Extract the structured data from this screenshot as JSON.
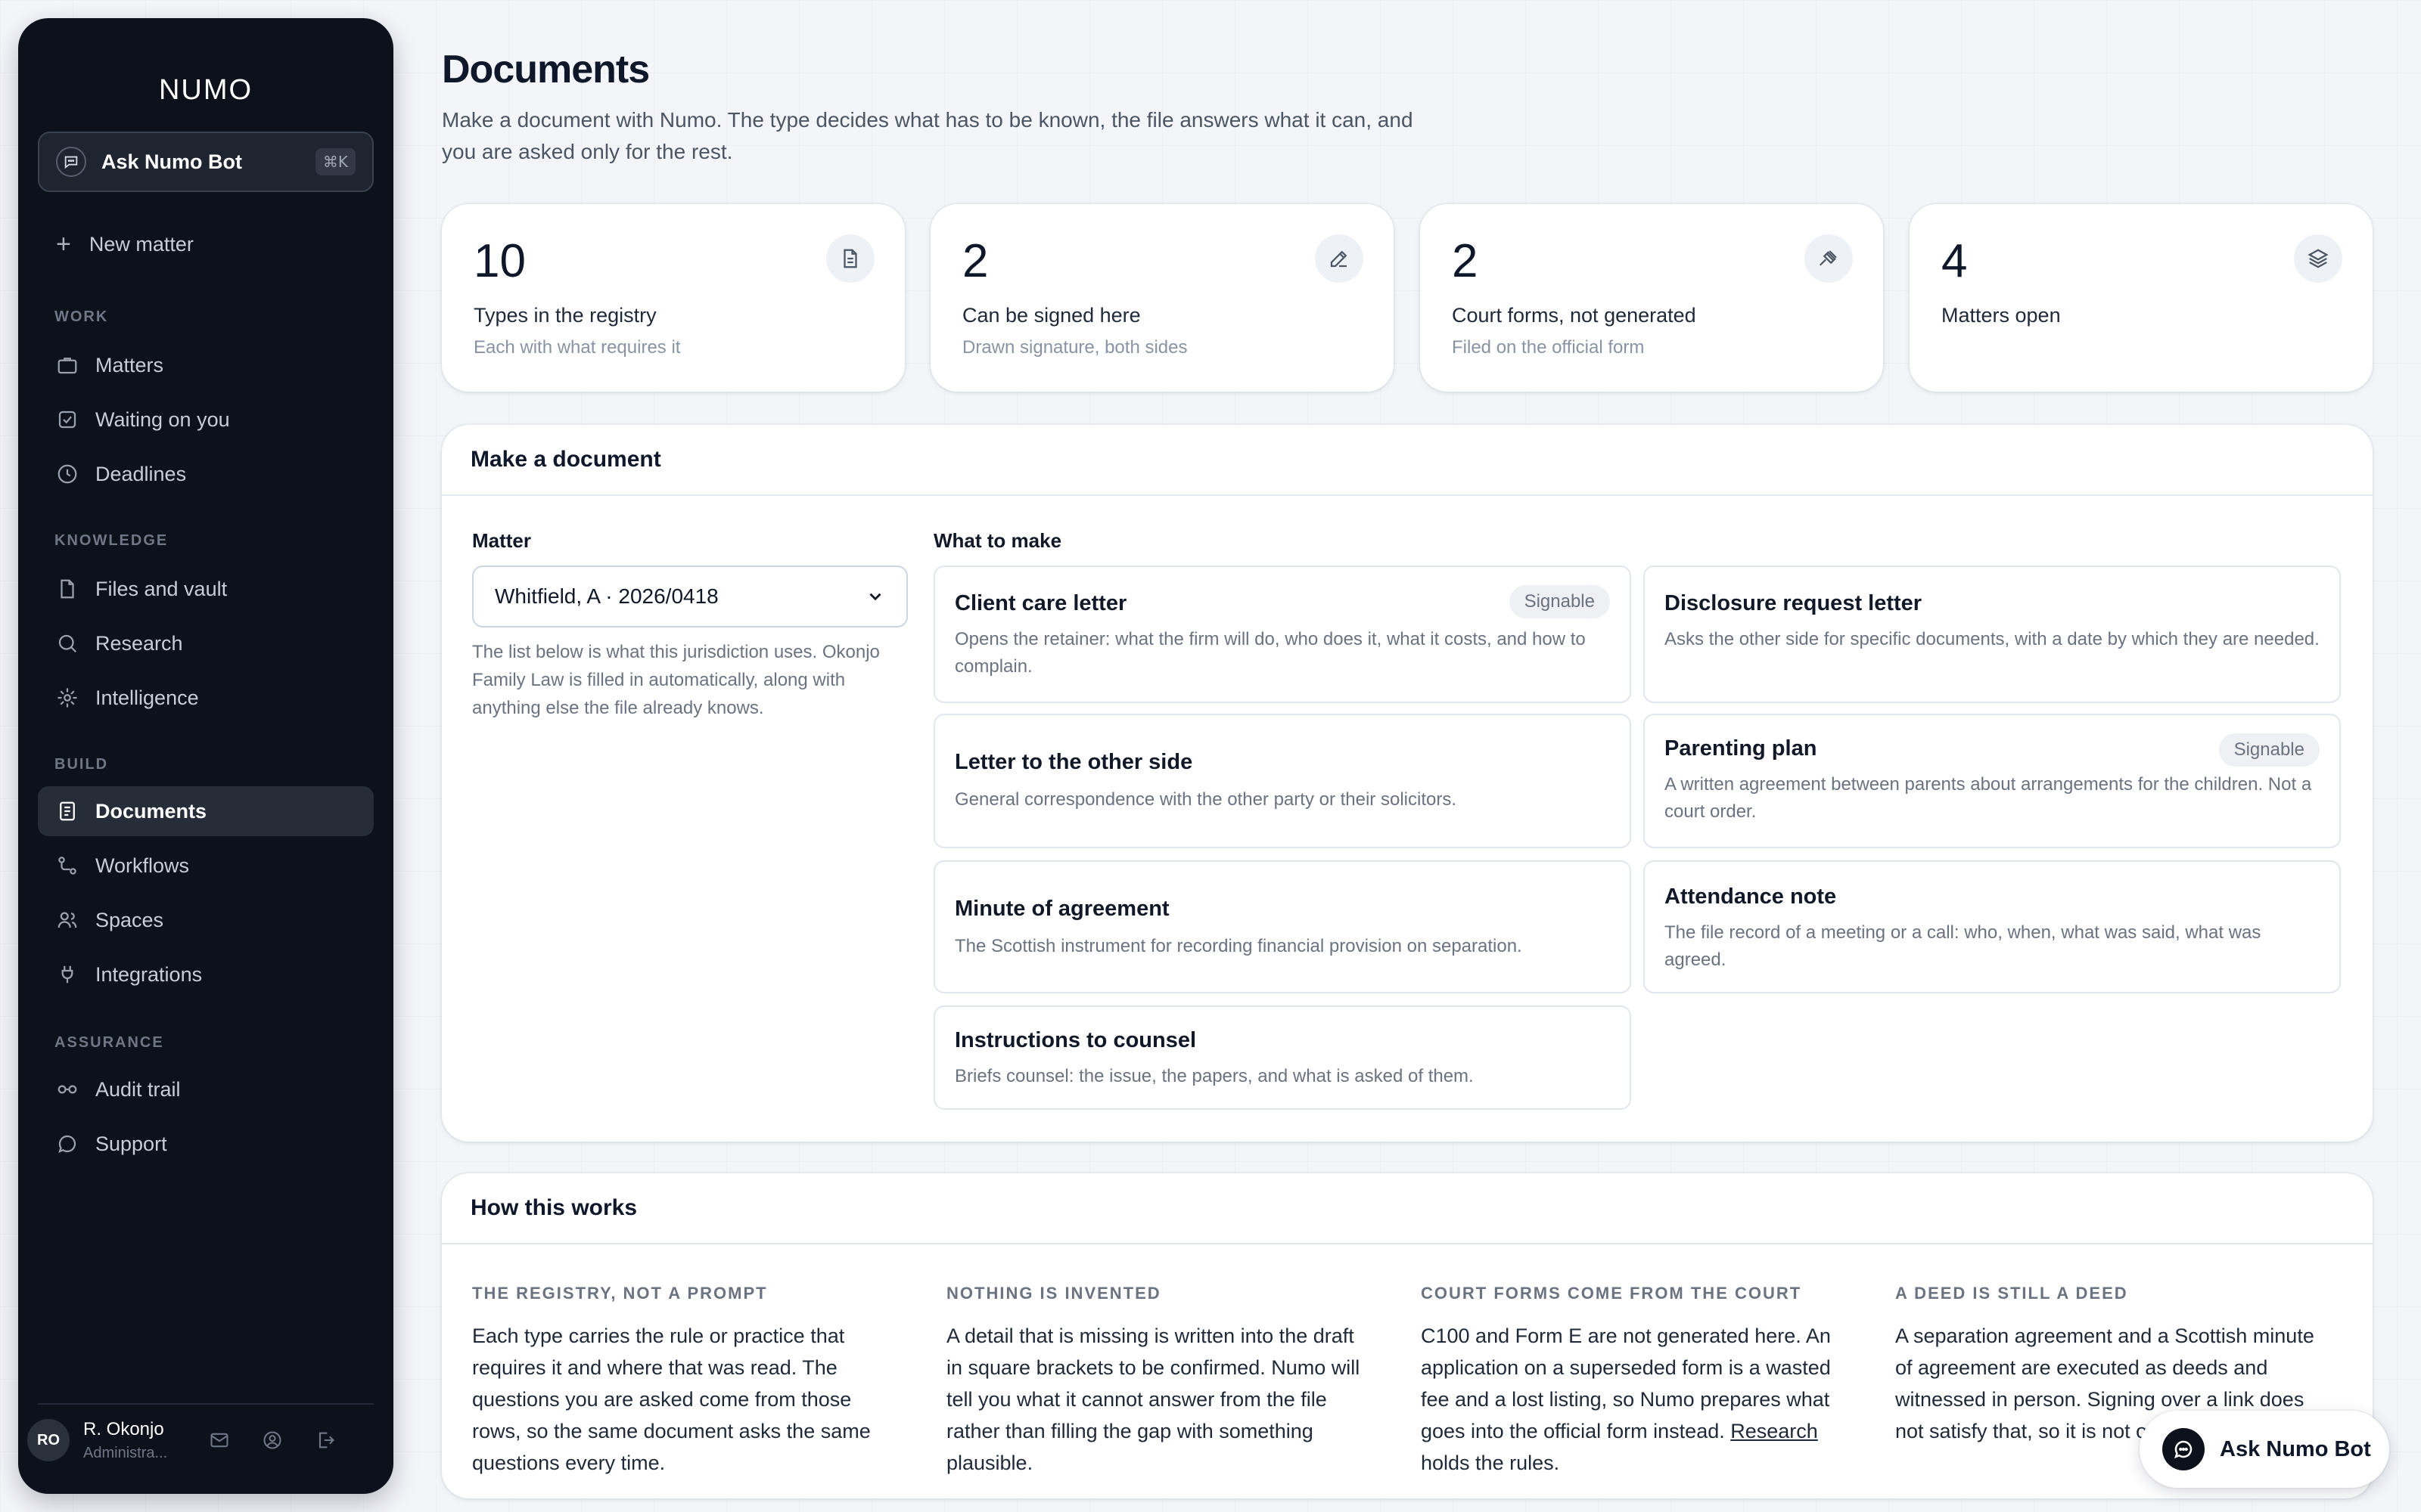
{
  "sidebar": {
    "logo": "NUMO",
    "ask_bot": {
      "label": "Ask Numo Bot",
      "shortcut": "⌘K"
    },
    "new_matter": "New matter",
    "sections": {
      "work": "WORK",
      "knowledge": "KNOWLEDGE",
      "build": "BUILD",
      "assurance": "ASSURANCE"
    },
    "items": {
      "matters": "Matters",
      "waiting": "Waiting on you",
      "deadlines": "Deadlines",
      "files": "Files and vault",
      "research": "Research",
      "intelligence": "Intelligence",
      "documents": "Documents",
      "workflows": "Workflows",
      "spaces": "Spaces",
      "integrations": "Integrations",
      "audit": "Audit trail",
      "support": "Support"
    },
    "active_item": "Documents",
    "user": {
      "initials": "RO",
      "name": "R. Okonjo",
      "role": "Administra..."
    }
  },
  "main": {
    "title": "Documents",
    "intro": "Make a document with Numo. The type decides what has to be known, the file answers what it can, and you are asked only for the rest.",
    "stats": [
      {
        "value": "10",
        "title": "Types in the registry",
        "sub": "Each with what requires it",
        "icon": "document-icon"
      },
      {
        "value": "2",
        "title": "Can be signed here",
        "sub": "Drawn signature, both sides",
        "icon": "pen-icon"
      },
      {
        "value": "2",
        "title": "Court forms, not generated",
        "sub": "Filed on the official form",
        "icon": "gavel-icon"
      },
      {
        "value": "4",
        "title": "Matters open",
        "sub": "",
        "icon": "layers-icon"
      }
    ],
    "make": {
      "heading": "Make a document",
      "matter_label": "Matter",
      "matter_value": "Whitfield, A · 2026/0418",
      "matter_hint": "The list below is what this jurisdiction uses. Okonjo Family Law is filled in automatically, along with anything else the file already knows.",
      "what_label": "What to make",
      "docs": [
        {
          "name": "Client care letter",
          "desc": "Opens the retainer: what the firm will do, who does it, what it costs, and how to complain.",
          "badge": "Signable"
        },
        {
          "name": "Disclosure request letter",
          "desc": "Asks the other side for specific documents, with a date by which they are needed.",
          "badge": ""
        },
        {
          "name": "Letter to the other side",
          "desc": "General correspondence with the other party or their solicitors.",
          "badge": ""
        },
        {
          "name": "Parenting plan",
          "desc": "A written agreement between parents about arrangements for the children. Not a court order.",
          "badge": "Signable"
        },
        {
          "name": "Minute of agreement",
          "desc": "The Scottish instrument for recording financial provision on separation.",
          "badge": ""
        },
        {
          "name": "Attendance note",
          "desc": "The file record of a meeting or a call: who, when, what was said, what was agreed.",
          "badge": ""
        },
        {
          "name": "Instructions to counsel",
          "desc": "Briefs counsel: the issue, the papers, and what is asked of them.",
          "badge": ""
        }
      ]
    },
    "how": {
      "heading": "How this works",
      "cols": [
        {
          "head": "THE REGISTRY, NOT A PROMPT",
          "text": "Each type carries the rule or practice that requires it and where that was read. The questions you are asked come from those rows, so the same document asks the same questions every time."
        },
        {
          "head": "NOTHING IS INVENTED",
          "text": "A detail that is missing is written into the draft in square brackets to be confirmed. Numo will tell you what it cannot answer from the file rather than filling the gap with something plausible."
        },
        {
          "head": "COURT FORMS COME FROM THE COURT",
          "text_before": "C100 and Form E are not generated here. An application on a superseded form is a wasted fee and a lost listing, so Numo prepares what goes into the official form instead. ",
          "link": "Research",
          "text_after": " holds the rules."
        },
        {
          "head": "A DEED IS STILL A DEED",
          "text": "A separation agreement and a Scottish minute of agreement are executed as deeds and witnessed in person. Signing over a link does not satisfy that, so it is not o"
        }
      ]
    },
    "float_bot": "Ask Numo Bot"
  }
}
